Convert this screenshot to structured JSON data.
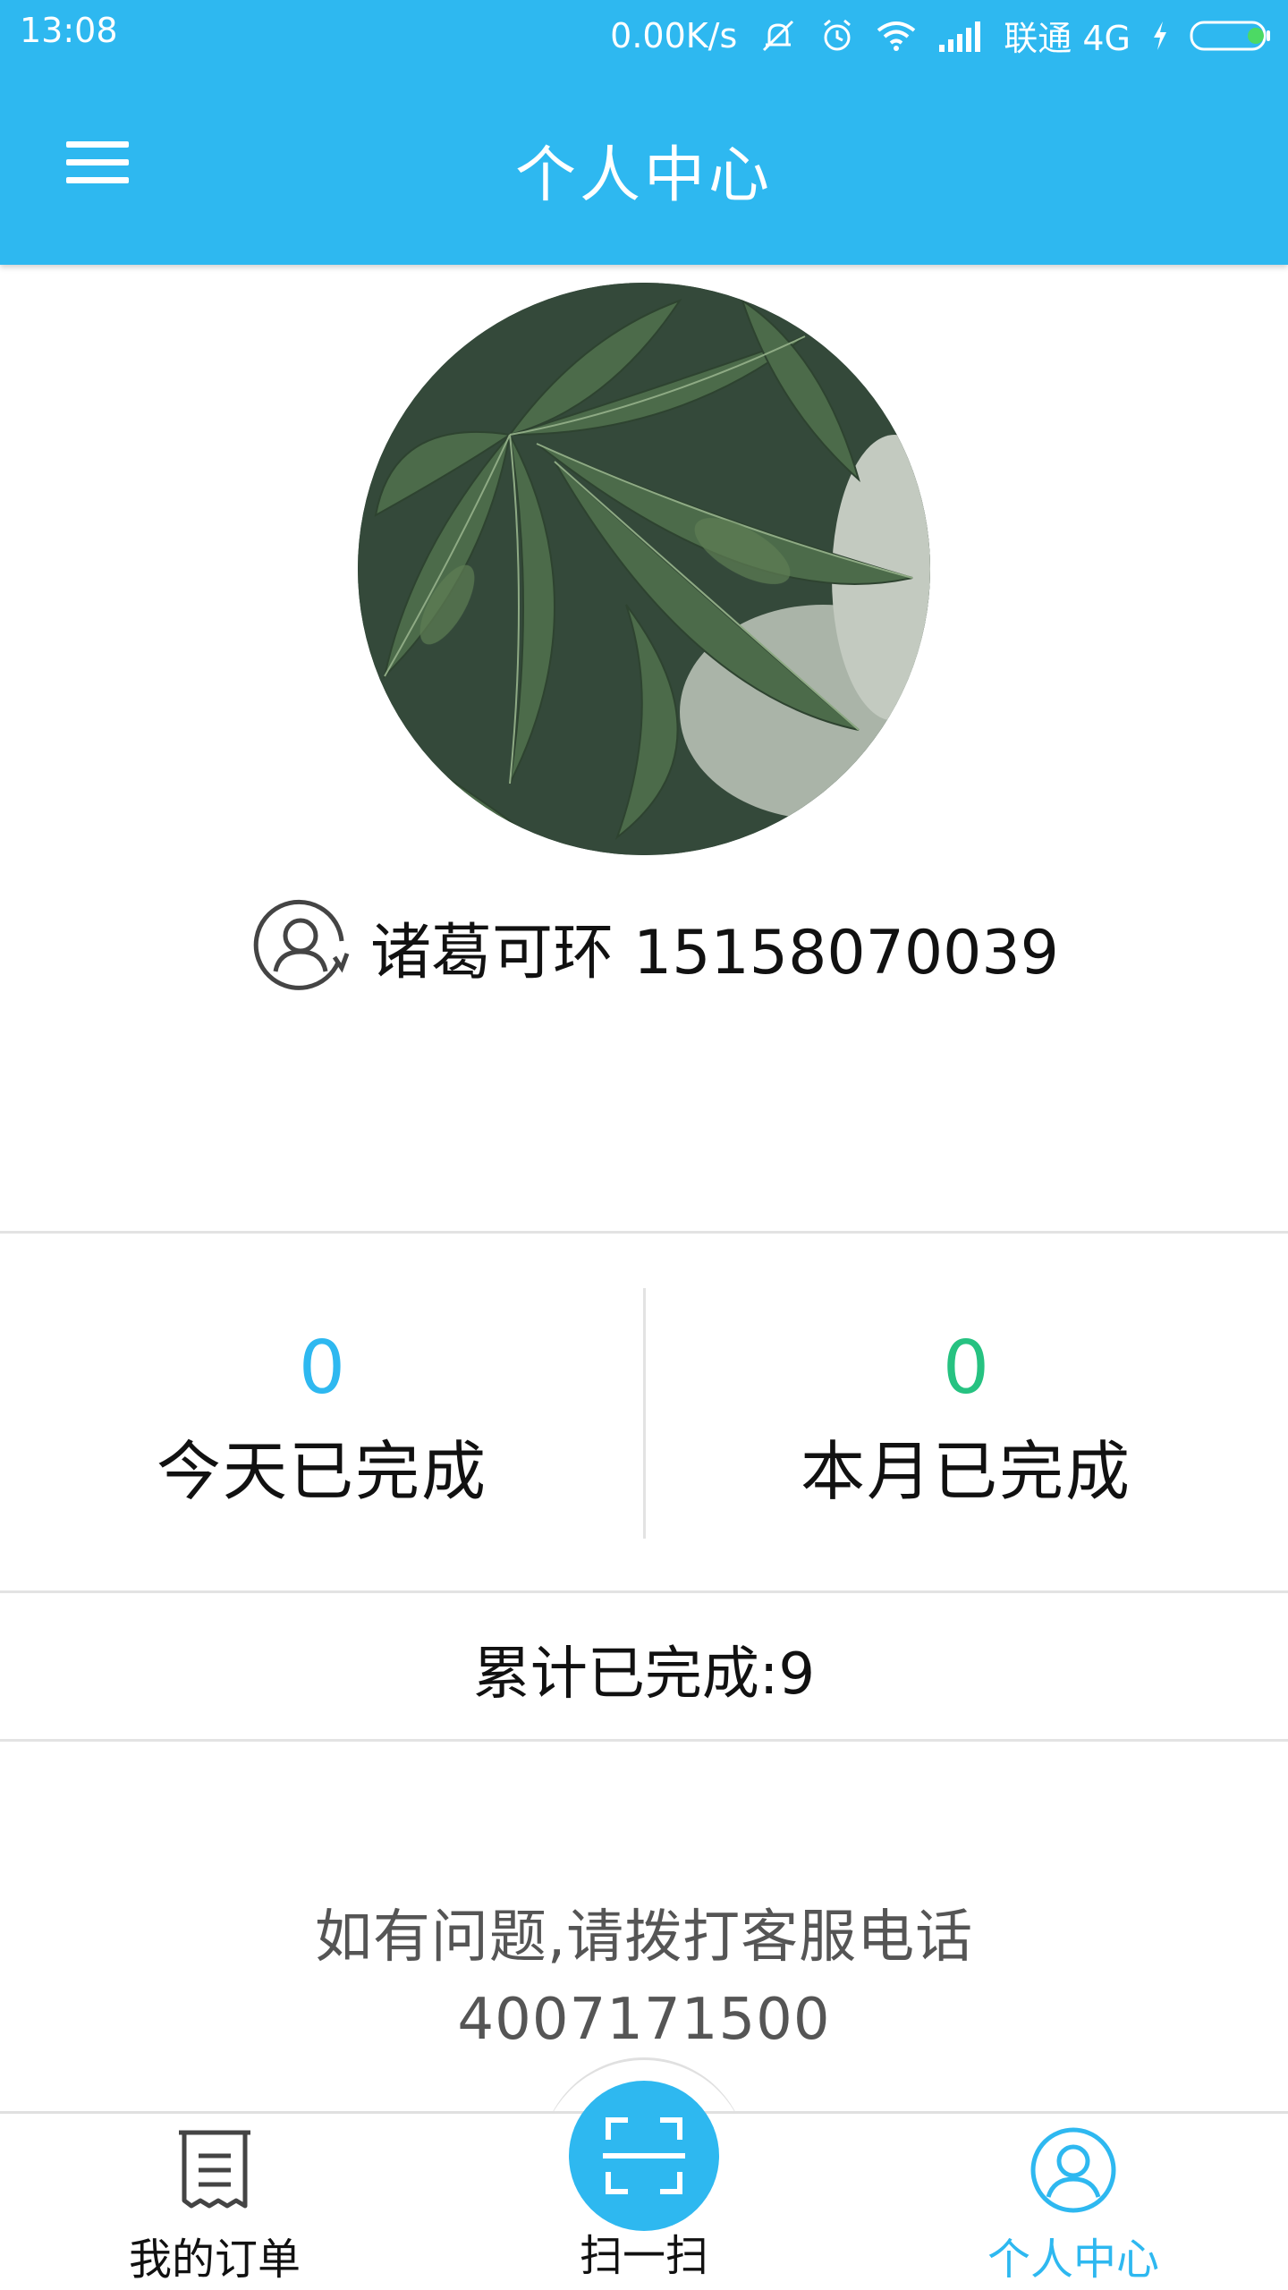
{
  "status_bar": {
    "time": "13:08",
    "speed": "0.00K/s",
    "carrier": "联通 4G"
  },
  "header": {
    "title": "个人中心",
    "menu_icon": "hamburger-menu-icon"
  },
  "profile": {
    "name": "诸葛可环",
    "phone": "15158070039"
  },
  "stats": {
    "today": {
      "value": "0",
      "label": "今天已完成",
      "color": "#2eb8f0"
    },
    "month": {
      "value": "0",
      "label": "本月已完成",
      "color": "#26c281"
    },
    "total": "累计已完成:9"
  },
  "contact": {
    "line1": "如有问题,请拨打客服电话",
    "phone": "4007171500"
  },
  "bottom_nav": {
    "orders": "我的订单",
    "scan": "扫一扫",
    "profile": "个人中心",
    "active_color": "#2eb8f0"
  }
}
